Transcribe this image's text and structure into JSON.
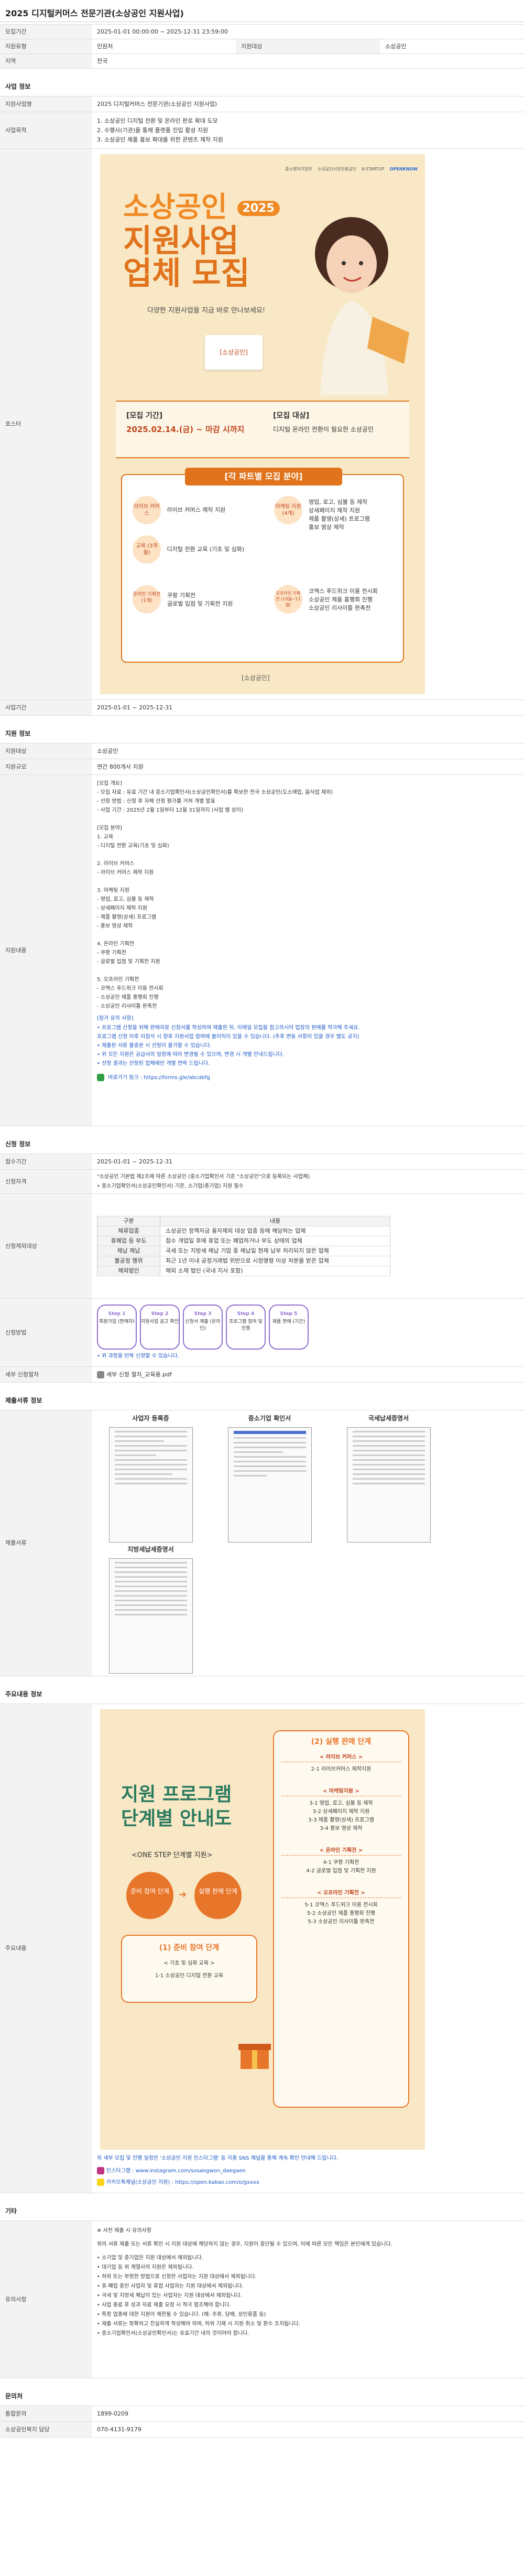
{
  "page_title": "2025 디지털커머스 전문기관(소상공인 지원사업)",
  "basic": {
    "period_label": "모집기간",
    "period_value": "2025-01-01 00:00:00 ~ 2025-12-31 23:59:00",
    "org_label": "지원유형",
    "org_value": "민원처",
    "agency_label": "지원대상",
    "agency_value": "소상공인",
    "region_label": "지역",
    "region_value": "전국"
  },
  "biz": {
    "section_title": "사업 정보",
    "name_label": "지원사업명",
    "name_value": "2025 디지털커머스 전문기관(소상공인 지원사업)",
    "desc_label": "사업목적",
    "desc_lines": [
      "1. 소상공인 디지털 전환 및 온라인 판로 확대 도모",
      "2. 수행사(기관)을 통해 플랫폼 진입 활성 지원",
      "3. 소상공인 제품 홍보 확대를 위한 콘텐츠 제작 지원"
    ],
    "poster_label": "포스터",
    "date_label": "사업기간",
    "date_value": "2025-01-01 ~ 2025-12-31"
  },
  "poster": {
    "logos": [
      "중소벤처기업부",
      "소상공인시장진흥공단",
      "K-STARTUP",
      "OPENKNOW"
    ],
    "tag_year": "2025",
    "headline1": "소상공인",
    "headline2": "지원사업",
    "headline3": "업체 모집",
    "sub": "다양한 지원사업을 지금 바로 만나보세요!",
    "box1_title": "[모집 기간]",
    "box1_value": "2025.02.14.(금) ~ 마감 시까지",
    "box2_title": "[모집 대상]",
    "box2_value": "디지털 온라인 전환이 필요한 소상공인",
    "field_title": "[각 파트별 모집 분야]",
    "fields": [
      {
        "name": "라이브 커머스",
        "items": [
          "라이브 커머스 제작 지원"
        ]
      },
      {
        "name": "마케팅 지원 (4개)",
        "items": [
          "영업, 로고, 심볼 등 제작",
          "상세페이지 제작 지원",
          "제품 촬영(상세) 프로그램",
          "홍보 영상 제작"
        ]
      },
      {
        "name": "교육 (3개월)",
        "items": [
          "디지털 전환 교육 (기초 및 심화)"
        ]
      },
      {
        "name": "온라인 기획전 (1개)",
        "items": [
          "쿠팡 기획전",
          "글로벌 입점 및 기획전 지원"
        ]
      },
      {
        "name": "오프라인 기획전 (10월~11월)",
        "items": [
          "코엑스 푸드위크 이용 전시회",
          "소상공인 제품 홍행회 진행",
          "소상공인 리사이틀 판촉전"
        ]
      }
    ],
    "footer_brand": "[소상공인]"
  },
  "support": {
    "section_title": "지원 정보",
    "target_label": "지원대상",
    "target_value": "소상공인",
    "scale_label": "지원규모",
    "scale_value": "연간 800개사 지원",
    "detail_label": "지원내용",
    "detail_lines": [
      "[모집 개요]",
      "- 모집 자료 : 유료 기간 내 중소기업확인서(소상공인확인서)를 확보한 전국 소상공인(도소매업, 음식업 제외)",
      "- 선정 방법 : 신청 후 자체 선정 평가를 거쳐 개별 발표",
      "- 사업 기간 : 2025년 2월 1일부터 12월 31일까지 (사업 별 상이)",
      "",
      "[모집 분야]",
      "1. 교육",
      "- 디지털 전환 교육(기초 및 심화)",
      "",
      "2. 라이브 커머스",
      "- 라이브 커머스 제작 지원",
      "",
      "3. 마케팅 지원",
      "- 영업, 로고, 심볼 등 제작",
      "- 상세페이지 제작 지원",
      "- 제품 촬영(상세) 프로그램",
      "- 홍보 영상 제작",
      "",
      "4. 온라인 기획전",
      "- 쿠팡 기획전",
      "- 글로벌 입점 및 기획전 지원",
      "",
      "5. 오프라인 기획전",
      "- 코엑스 푸드위크 이용 전시회",
      "- 소상공인 제품 홍행회 진행",
      "- 소상공인 리사이틀 판촉전"
    ],
    "notice_title": "[참가 유의 사항]",
    "notice_lines": [
      "• 프로그램 신청을 위해 판매자로 신청서를 작성하여 제출한 뒤, 이메일 모집을 참고하시어 업장의 판매를 적극해 주세요.",
      "프로그램 신청 이후 미참석 시 향후 지원사업 참여에 불이익이 있을 수 있습니다. (추후 변동 사항이 있을 경우 별도 공지)",
      "• 제출된 서류 불충분 시 선정이 불가할 수 있습니다.",
      "• 위 모든 지원은 공급사의 일정에 따라 변경될 수 있으며, 변경 시 개별 안내드립니다.",
      "• 선정 결과는 선정된 업체에만 개별 연락 드립니다."
    ],
    "link_text": "바로가기 링크 : https://forms.gle/abcdefg"
  },
  "apply": {
    "section_title": "신청 정보",
    "date_label": "접수기간",
    "date_value": "2025-01-01 ~ 2025-12-31",
    "qual_label": "신청자격",
    "qual_lines": [
      "\"소상공인 기본법 제2조에 따른 소상공인 (중소기업확인서 기준 \"소상공인\"으로 등록되는 사업체)",
      "• 중소기업확인서(소상공인확인서) 기준, 소기업(종기업) 지원 필수"
    ],
    "exclude_label": "신청제외대상",
    "exclude_rows": [
      {
        "k": "구분",
        "v": "내용"
      },
      {
        "k": "체류업종",
        "v": "소상공인 정책자금 융자제외 대상 업종 등에 해당하는 업체"
      },
      {
        "k": "휴폐업 등 부도",
        "v": "접수 개업일 후에 휴업 또는 폐업하거나 부도 상태의 업체"
      },
      {
        "k": "체납 제납",
        "v": "국세 또는 지방세 체납 기업 중 체납일 현재 납부 처리되지 않은 업체"
      },
      {
        "k": "불공정 행위",
        "v": "최근 1년 이내 공정거래법 위반으로 시정명령 이상 처분을 받은 업체"
      },
      {
        "k": "해외법인",
        "v": "해외 소재 법인 (국내 지사 포함)"
      }
    ],
    "method_label": "신청방법",
    "steps": [
      {
        "n": "Step 1",
        "t": "회원가입 (판매자)"
      },
      {
        "n": "Step 2",
        "t": "지원사업 공고 확인"
      },
      {
        "n": "Step 3",
        "t": "신청서 제출 (온라인)"
      },
      {
        "n": "Step 4",
        "t": "프로그램 참여 및 진행"
      },
      {
        "n": "Step 5",
        "t": "제품 판매 (기간)"
      }
    ],
    "method_note": "• 위 과정을 반복 신청할 수 있습니다.",
    "file_label": "세부 신청절차",
    "file_value": "세부 신청 절차_교육용.pdf"
  },
  "docs": {
    "section_title": "제출서류 정보",
    "label": "제출서류",
    "items": [
      "사업자 등록증",
      "중소기업 확인서",
      "국세납세증명서",
      "지방세납세증명서"
    ]
  },
  "main": {
    "section_title": "주요내용 정보",
    "label": "주요내용",
    "poster_title1": "지원 프로그램",
    "poster_title2": "단계별 안내도",
    "onestep": "<ONE STEP 단계별 지원>",
    "phase1_title": "(1) 준비 참여 단계",
    "phase1_items": [
      "< 기초 및 심화 교육 >",
      "1-1 소상공인 디지털 전환 교육"
    ],
    "left_circle": "준비 참여 단계",
    "right_circle": "실행 판매 단계",
    "phase2_title": "(2) 실행 판매 단계",
    "phase2_groups": [
      {
        "h": "< 라이브 커머스 >",
        "items": [
          "2-1 라이브커머스 제작지원"
        ]
      },
      {
        "h": "< 마케팅지원 >",
        "items": [
          "3-1 영업, 로고, 심볼 등 제작",
          "3-2 상세페이지 제작 지원",
          "3-3 제품 촬영(상세) 프로그램",
          "3-4 홍보 영상 제작"
        ]
      },
      {
        "h": "< 온라인 기획전 >",
        "items": [
          "4-1 쿠팡 기획전",
          "4-2 글로벌 입점 및 기획전 지원"
        ]
      },
      {
        "h": "< 오프라인 기획전 >",
        "items": [
          "5-1 코엑스 푸드위크 이용 전시회",
          "5-2 소상공인 제품 홍행회 진행",
          "5-3 소상공인 리사이틀 판촉전"
        ]
      }
    ],
    "note": "위 세부 모집 및 진행 일정은 '소상공인 지원 인스타그램' 등 각종 SNS 채널을 통해 계속 확인 안내해 드립니다.",
    "link1": "인스타그램 : www.instagram.com/sosangwon_daegaen",
    "link2": "카카오톡채널(소상공인 지원) : https://open.kakao.com/o/gxxxx"
  },
  "etc": {
    "section_title": "기타",
    "label": "유의사항",
    "head": "※ 사전 제출 시 유의사항",
    "intro": "위의 서류 제출 또는 서류 확인 시 지원 대상에 해당하지 않는 경우, 지원이 중단될 수 있으며, 이에 따른 모든 책임은 본인에게 있습니다.",
    "lines": [
      "• 소기업 및 중기업은 지원 대상에서 제외됩니다.",
      "• 대기업 등 위 계열사의 지원은 제외됩니다.",
      "• 허위 또는 부정한 방법으로 신청한 사업자는 지원 대상에서 제외됩니다.",
      "• 휴·폐업 중인 사업자 및 휴업 사업자는 지원 대상에서 제외됩니다.",
      "• 국세 및 지방세 체납이 있는 사업자는 지원 대상에서 제외됩니다.",
      "• 사업 종료 후 성과 자료 제출 요청 시 적극 협조해야 합니다.",
      "• 특정 업종에 대한 지원이 제한될 수 있습니다. (예: 주류, 담배, 성인용품 등)",
      "• 제출 서류는 정확하고 진실하게 작성해야 하며, 허위 기재 시 지원 취소 및 환수 조치됩니다.",
      "• 중소기업확인서(소상공인확인서)는 유효기간 내의 것이어야 합니다."
    ]
  },
  "contact": {
    "section_title": "문의처",
    "phone_label": "통합문의",
    "phone_value": "1899-0209",
    "center_label": "소상공인복지 담당",
    "center_value": "070-4131-9179"
  },
  "colors": {
    "accent": "#1a56c4",
    "poster_bg": "#f8e8c6",
    "step_border": "#8f6fd1",
    "brand_orange": "#f08a24"
  }
}
